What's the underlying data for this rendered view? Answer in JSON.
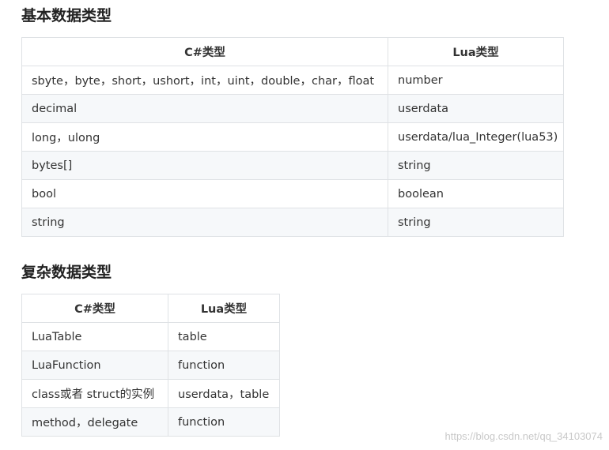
{
  "sections": [
    {
      "heading": "基本数据类型",
      "columns": [
        "C#类型",
        "Lua类型"
      ],
      "rows": [
        [
          "sbyte，byte，short，ushort，int，uint，double，char，float",
          "number"
        ],
        [
          "decimal",
          "userdata"
        ],
        [
          "long，ulong",
          "userdata/lua_Integer(lua53)"
        ],
        [
          "bytes[]",
          "string"
        ],
        [
          "bool",
          "boolean"
        ],
        [
          "string",
          "string"
        ]
      ]
    },
    {
      "heading": "复杂数据类型",
      "columns": [
        "C#类型",
        "Lua类型"
      ],
      "rows": [
        [
          "LuaTable",
          "table"
        ],
        [
          "LuaFunction",
          "function"
        ],
        [
          "class或者 struct的实例",
          "userdata，table"
        ],
        [
          "method，delegate",
          "function"
        ]
      ]
    }
  ],
  "watermark": "https://blog.csdn.net/qq_34103074",
  "colors": {
    "border": "#dfe2e5",
    "stripe": "#f6f8fa",
    "text": "#333333",
    "heading": "#222222"
  }
}
